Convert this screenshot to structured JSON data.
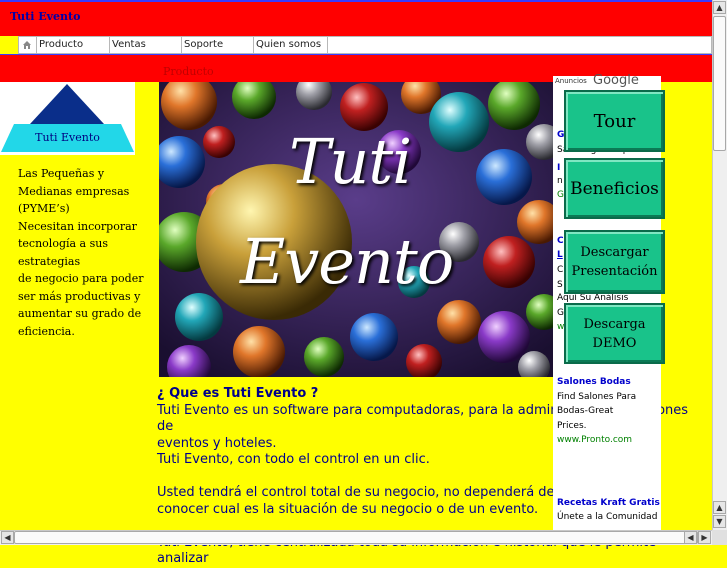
{
  "site": {
    "title": "Tuti Evento"
  },
  "nav": {
    "items": [
      {
        "label": "Producto"
      },
      {
        "label": "Ventas"
      },
      {
        "label": "Soporte"
      },
      {
        "label": "Quien somos"
      }
    ]
  },
  "band2": {
    "label": "Producto"
  },
  "logo": {
    "text": "Tuti Evento"
  },
  "left_text": {
    "lines": [
      "Las Pequeñas y",
      "Medianas empresas",
      "(PYME’s)",
      "Necesitan incorporar",
      "tecnología a sus",
      "estrategias",
      "de negocio para poder",
      "ser más productivas y",
      "aumentar su grado de",
      "eficiencia."
    ]
  },
  "hero": {
    "line1": "Tuti",
    "line2": "Evento"
  },
  "main": {
    "question": "¿ Que es Tuti Evento ?",
    "p1a": "Tuti Evento es un software para computadoras, para la administración de salones de",
    "p1b": "eventos y hoteles.",
    "p2": "Tuti Evento, con todo el control en un clic.",
    "p3a": "Usted tendrá el control total de su negocio, no dependerá del personal para",
    "p3b": "conocer cual es la situación de su negocio o de un evento.",
    "p4": "Tuti Evento, tiene centralizada toda su información e historial que le permite analizar"
  },
  "ads": {
    "header": "Anuncios",
    "brand": "Google",
    "frag1": "G",
    "frag2": "Save Big on Top-Rated",
    "frag3": "I",
    "frag4": "n",
    "frag5": "G",
    "frag6": "C",
    "frag7": "L",
    "frag8": "C",
    "frag9": "S",
    "frag10": "Aquí Su Análisis",
    "frag11": "G",
    "frag12": "w",
    "ad_a_title": "Salones Bodas",
    "ad_a_line1": "Find Salones Para",
    "ad_a_line2": "Bodas-Great",
    "ad_a_line3": "Prices.",
    "ad_a_url": "www.Pronto.com",
    "ad_b_title": "Recetas Kraft Gratis",
    "ad_b_line1": "Únete a la Comunidad"
  },
  "buttons": {
    "tour": "Tour",
    "beneficios": "Beneficios",
    "descargar_line1": "Descargar",
    "descargar_line2": "Presentación",
    "demo_line1": "Descarga",
    "demo_line2": "DEMO"
  },
  "colors": {
    "red_band": "#ff0000",
    "page_bg": "#ffff00",
    "button_green": "#19c38a",
    "text_blue": "#00008b"
  }
}
